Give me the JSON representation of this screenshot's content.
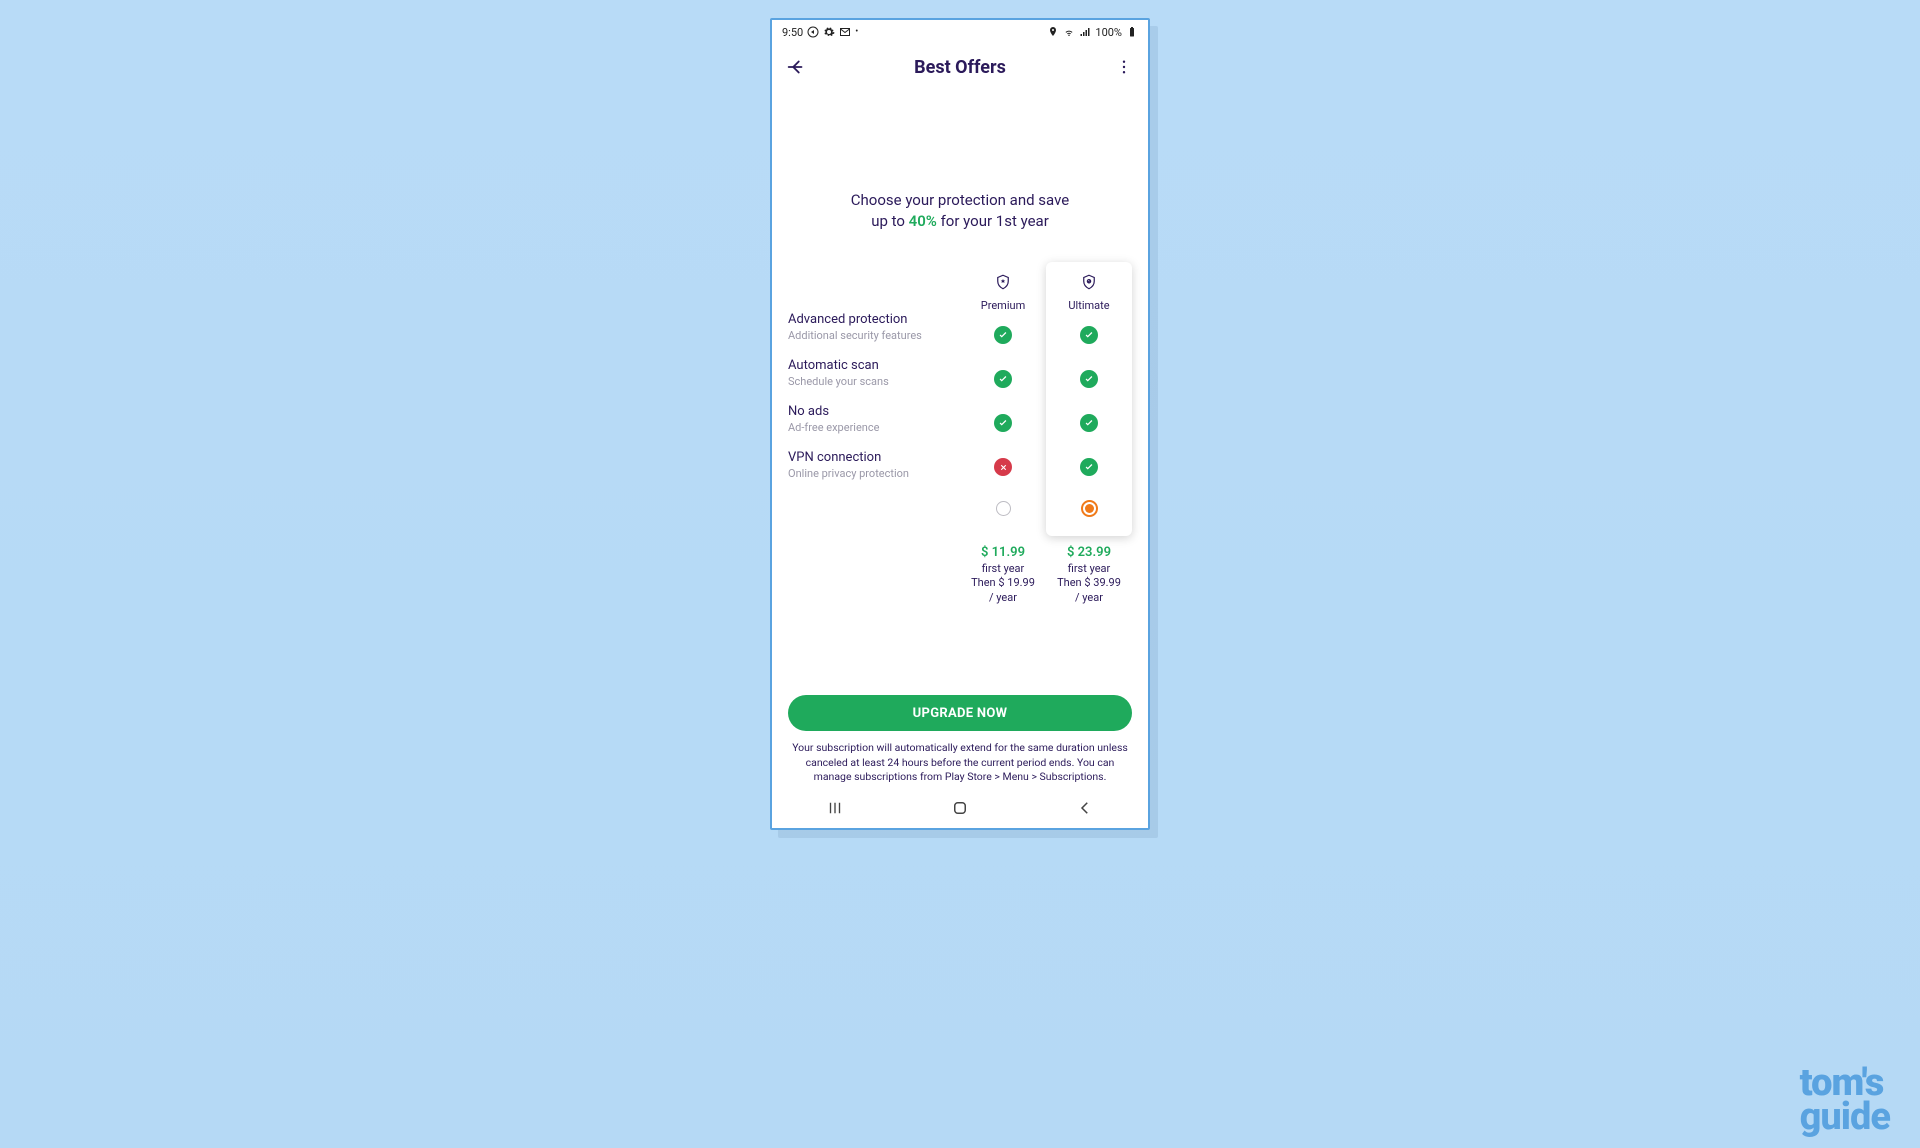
{
  "status": {
    "time": "9:50",
    "battery": "100%"
  },
  "app": {
    "title": "Best Offers"
  },
  "promo": {
    "line1": "Choose your protection and save",
    "line2a": "up to ",
    "pct": "40%",
    "line2b": " for your 1st year"
  },
  "plans": {
    "premium": {
      "name": "Premium",
      "selected": false,
      "features": {
        "advanced": true,
        "autoscan": true,
        "noads": true,
        "vpn": false
      },
      "price_main": "$ 11.99",
      "price_sub1": "first year",
      "price_sub2": "Then $ 19.99",
      "price_sub3": "/ year"
    },
    "ultimate": {
      "name": "Ultimate",
      "selected": true,
      "features": {
        "advanced": true,
        "autoscan": true,
        "noads": true,
        "vpn": true
      },
      "price_main": "$ 23.99",
      "price_sub1": "first year",
      "price_sub2": "Then $ 39.99",
      "price_sub3": "/ year"
    }
  },
  "features": [
    {
      "title": "Advanced protection",
      "sub": "Additional security features"
    },
    {
      "title": "Automatic scan",
      "sub": "Schedule your scans"
    },
    {
      "title": "No ads",
      "sub": "Ad-free experience"
    },
    {
      "title": "VPN connection",
      "sub": "Online privacy protection"
    }
  ],
  "cta": {
    "label": "UPGRADE NOW"
  },
  "fineprint": "Your subscription will automatically extend for the same duration unless canceled at least 24 hours before the current period ends. You can manage subscriptions from Play Store > Menu > Subscriptions.",
  "watermark": {
    "top": "tom's",
    "bottom": "guide"
  }
}
